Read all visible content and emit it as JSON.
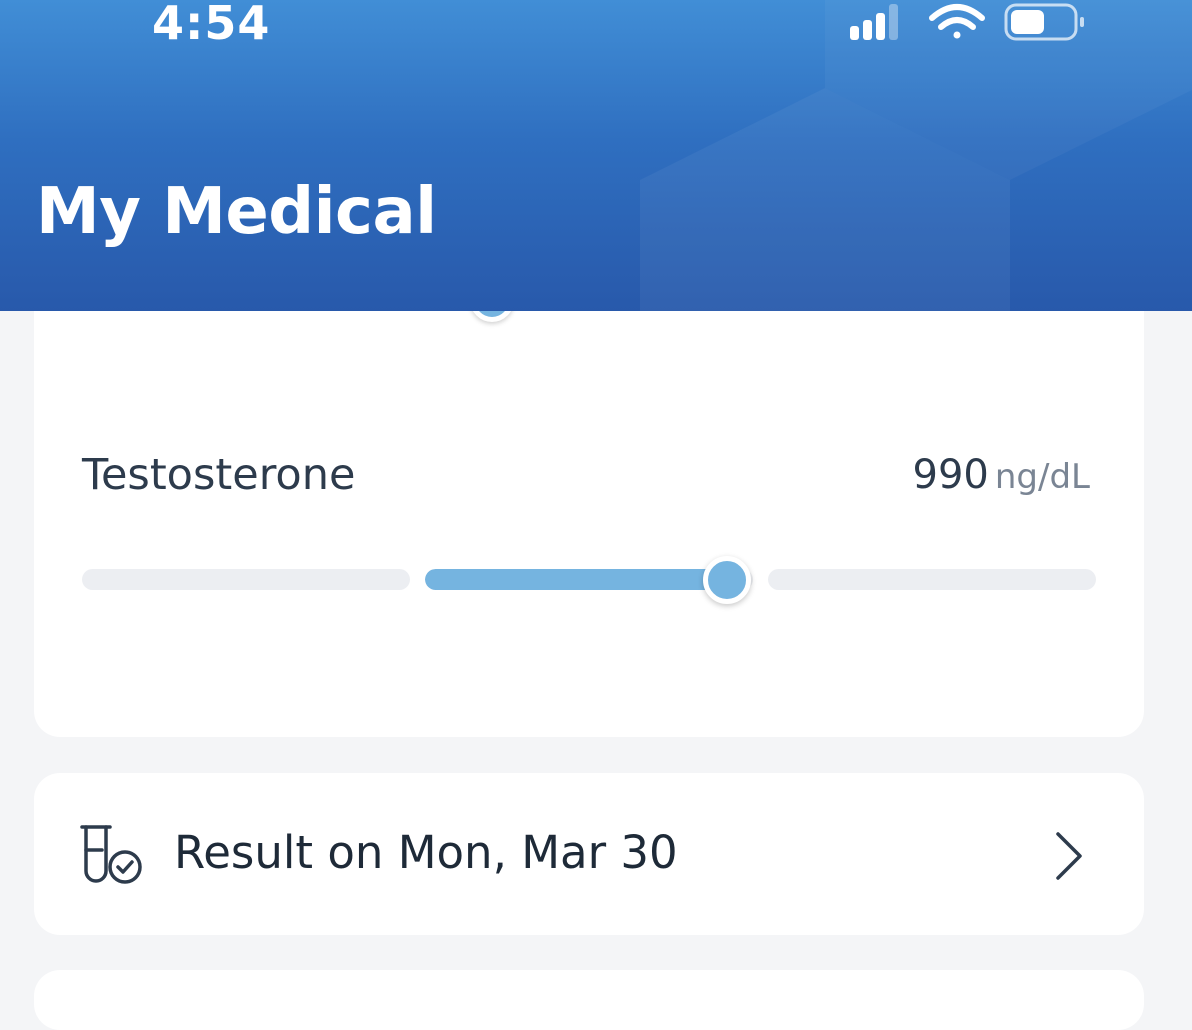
{
  "status_bar": {
    "time": "4:54",
    "icons": [
      "cellular-signal-icon",
      "wifi-icon",
      "battery-icon"
    ]
  },
  "header": {
    "title": "My Medical",
    "gradient": [
      "#418ed6",
      "#2859ab"
    ]
  },
  "biomarker": {
    "name": "Testosterone",
    "value": "990",
    "unit": "ng/dL",
    "range_segments": 3,
    "active_segment": 2,
    "position_in_segment": 0.92,
    "accent_color": "#75b4e0"
  },
  "result_row": {
    "icon": "test-tube-check-icon",
    "label": "Result on Mon, Mar 30",
    "chevron": "chevron-right-icon"
  }
}
